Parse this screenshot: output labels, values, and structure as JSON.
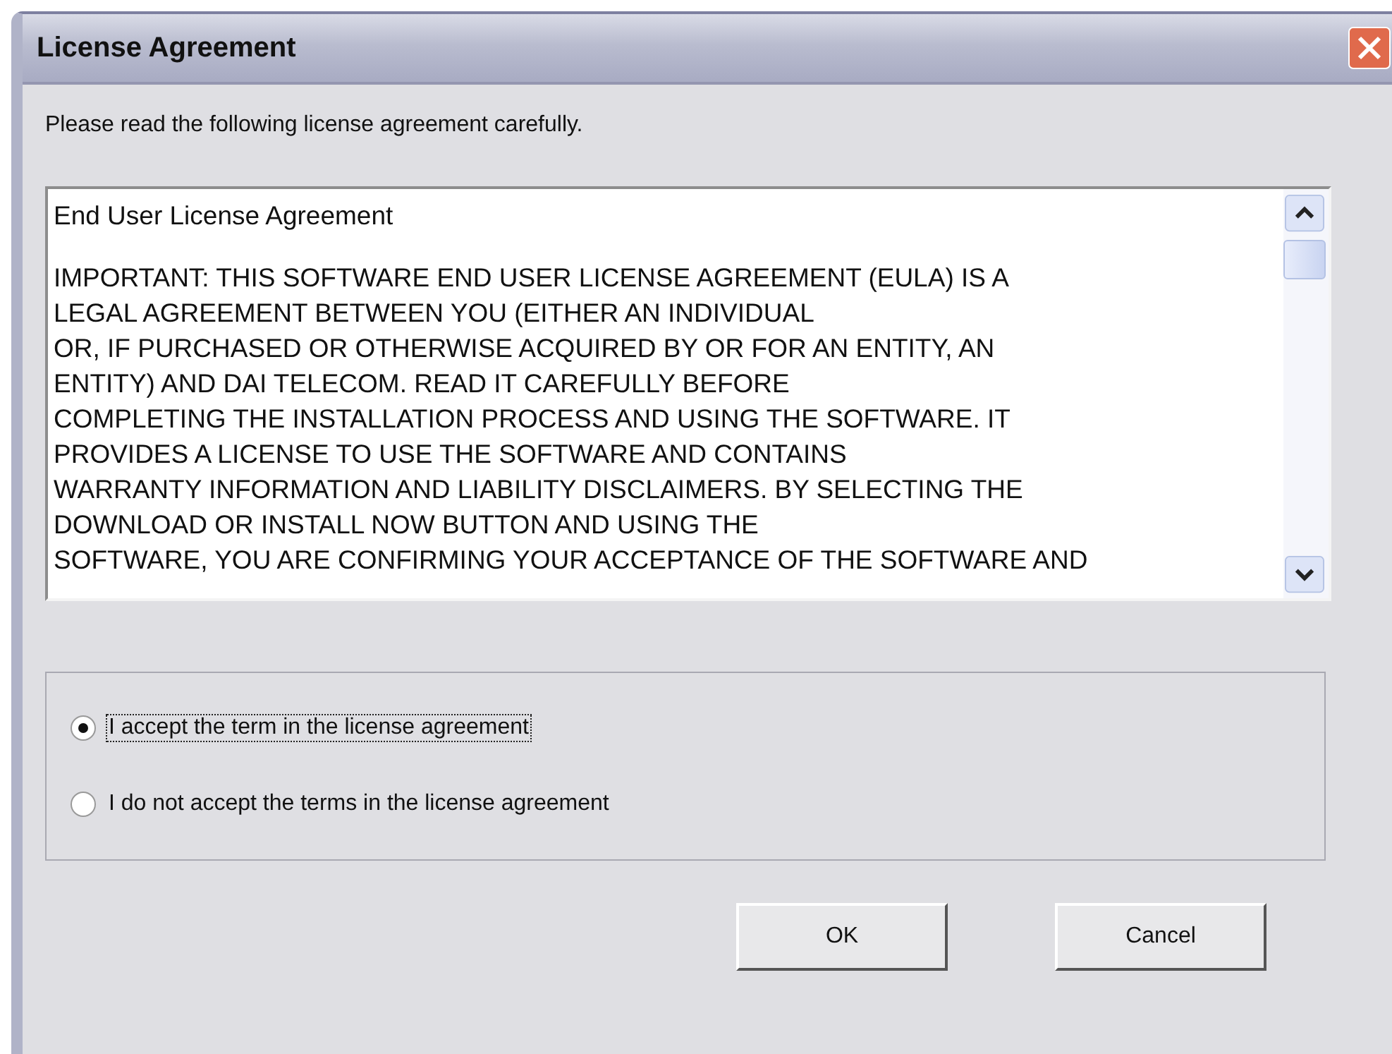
{
  "window": {
    "title": "License Agreement"
  },
  "instruction": "Please read the following license agreement carefully.",
  "license_text": {
    "heading": "End User License Agreement",
    "lines": [
      "IMPORTANT: THIS SOFTWARE END USER LICENSE AGREEMENT (EULA) IS A",
      "LEGAL AGREEMENT BETWEEN YOU (EITHER AN INDIVIDUAL",
      "OR, IF PURCHASED OR OTHERWISE ACQUIRED BY OR FOR AN ENTITY, AN",
      "ENTITY) AND DAI TELECOM. READ IT CAREFULLY BEFORE",
      "COMPLETING THE INSTALLATION PROCESS AND USING THE SOFTWARE. IT",
      "PROVIDES A LICENSE TO USE THE SOFTWARE AND CONTAINS",
      "WARRANTY INFORMATION AND LIABILITY DISCLAIMERS. BY SELECTING THE",
      "DOWNLOAD OR INSTALL NOW BUTTON AND USING THE",
      "SOFTWARE, YOU ARE CONFIRMING YOUR ACCEPTANCE OF THE SOFTWARE AND"
    ]
  },
  "options": [
    {
      "label": "I accept the term in the license agreement",
      "selected": true,
      "focused": true
    },
    {
      "label": "I do not accept the terms in the license agreement",
      "selected": false,
      "focused": false
    }
  ],
  "buttons": [
    {
      "label": "OK"
    },
    {
      "label": "Cancel"
    }
  ]
}
